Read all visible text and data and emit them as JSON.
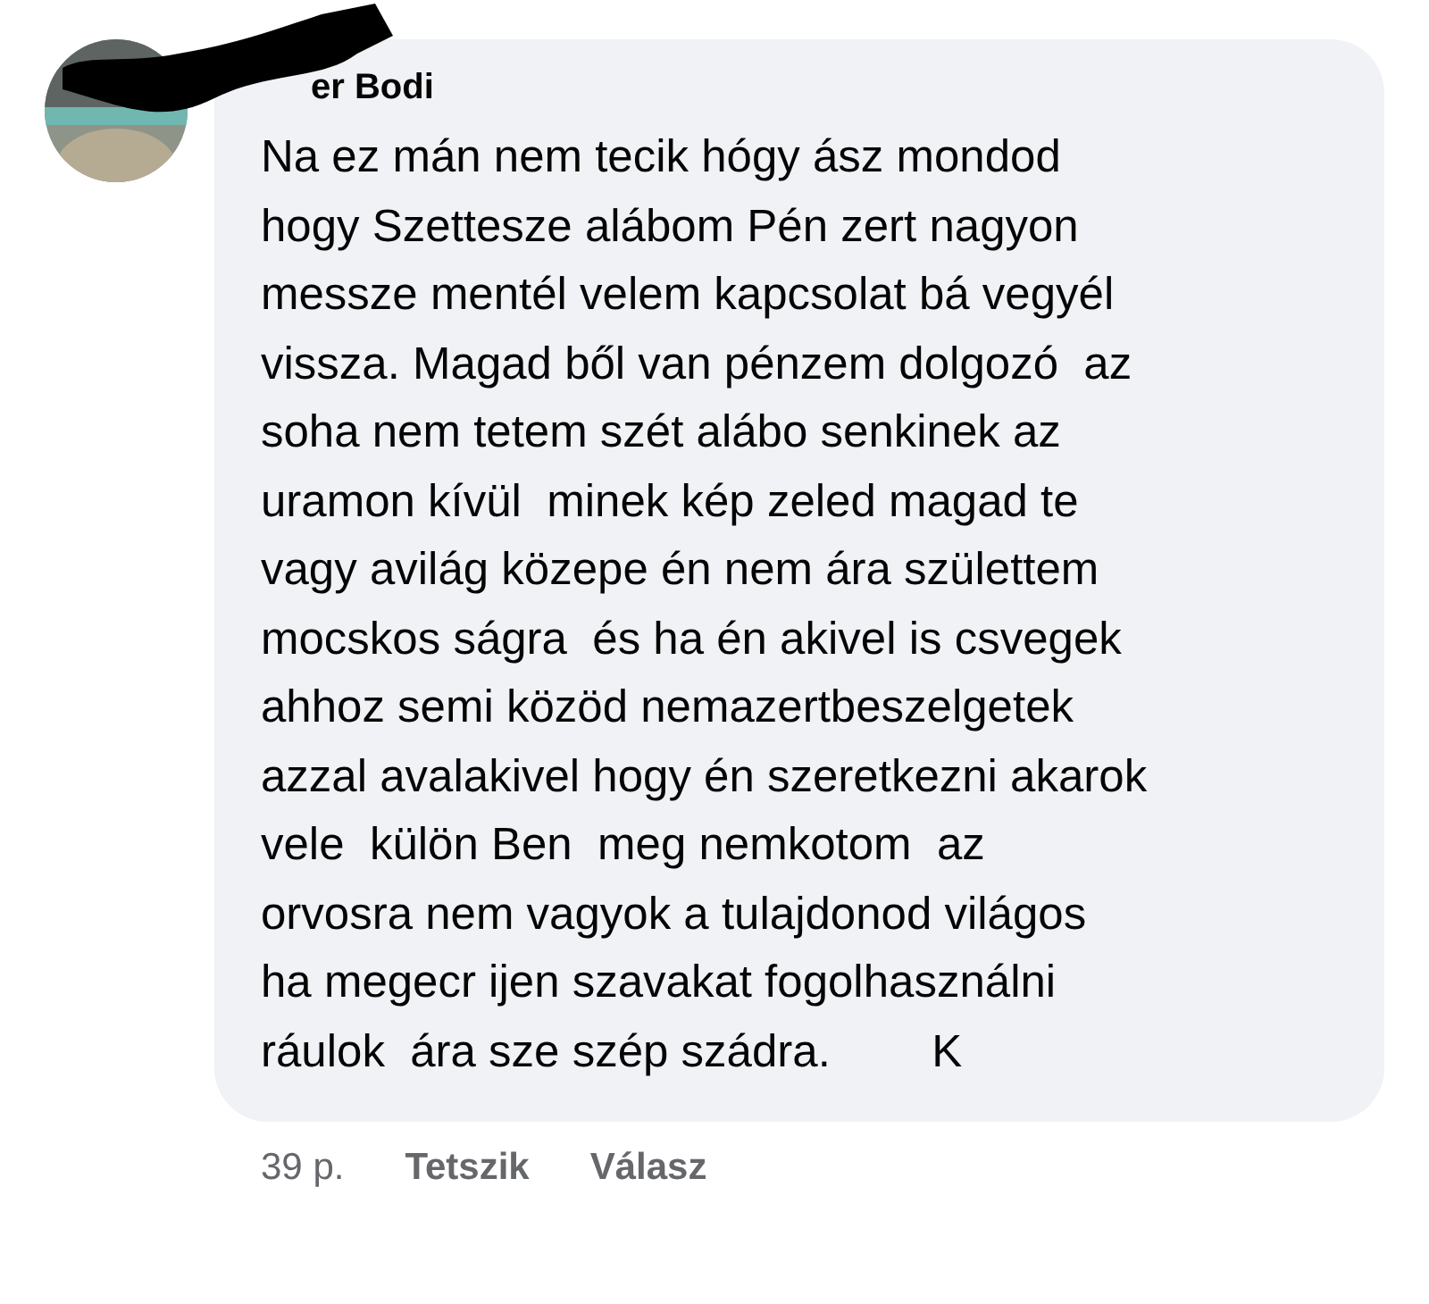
{
  "comment": {
    "author": "er Bodi",
    "lines": [
      "Na ez mán nem tecik hógy ász mondod",
      "hogy Szettesze alábom Pén zert nagyon",
      "messze mentél velem kapcsolat bá vegyél",
      "vissza. Magad ből van pénzem dolgozó  az",
      "soha nem tetem szét alábo senkinek az",
      "uramon kívül  minek kép zeled magad te",
      "vagy avilág közepe én nem ára születtem",
      "mocskos ságra  és ha én akivel is csvegek",
      "ahhoz semi közöd nemazertbeszelgetek",
      "azzal avalakivel hogy én szeretkezni akarok",
      "vele  külön Ben  meg nemkotom  az",
      "orvosra nem vagyok a tulajdonod világos",
      "ha megecr ijen szavakat fogolhasználni",
      "ráulok  ára sze szép szádra.        K"
    ],
    "time": "39 p.",
    "actions": [
      "Tetszik",
      "Válasz"
    ]
  }
}
